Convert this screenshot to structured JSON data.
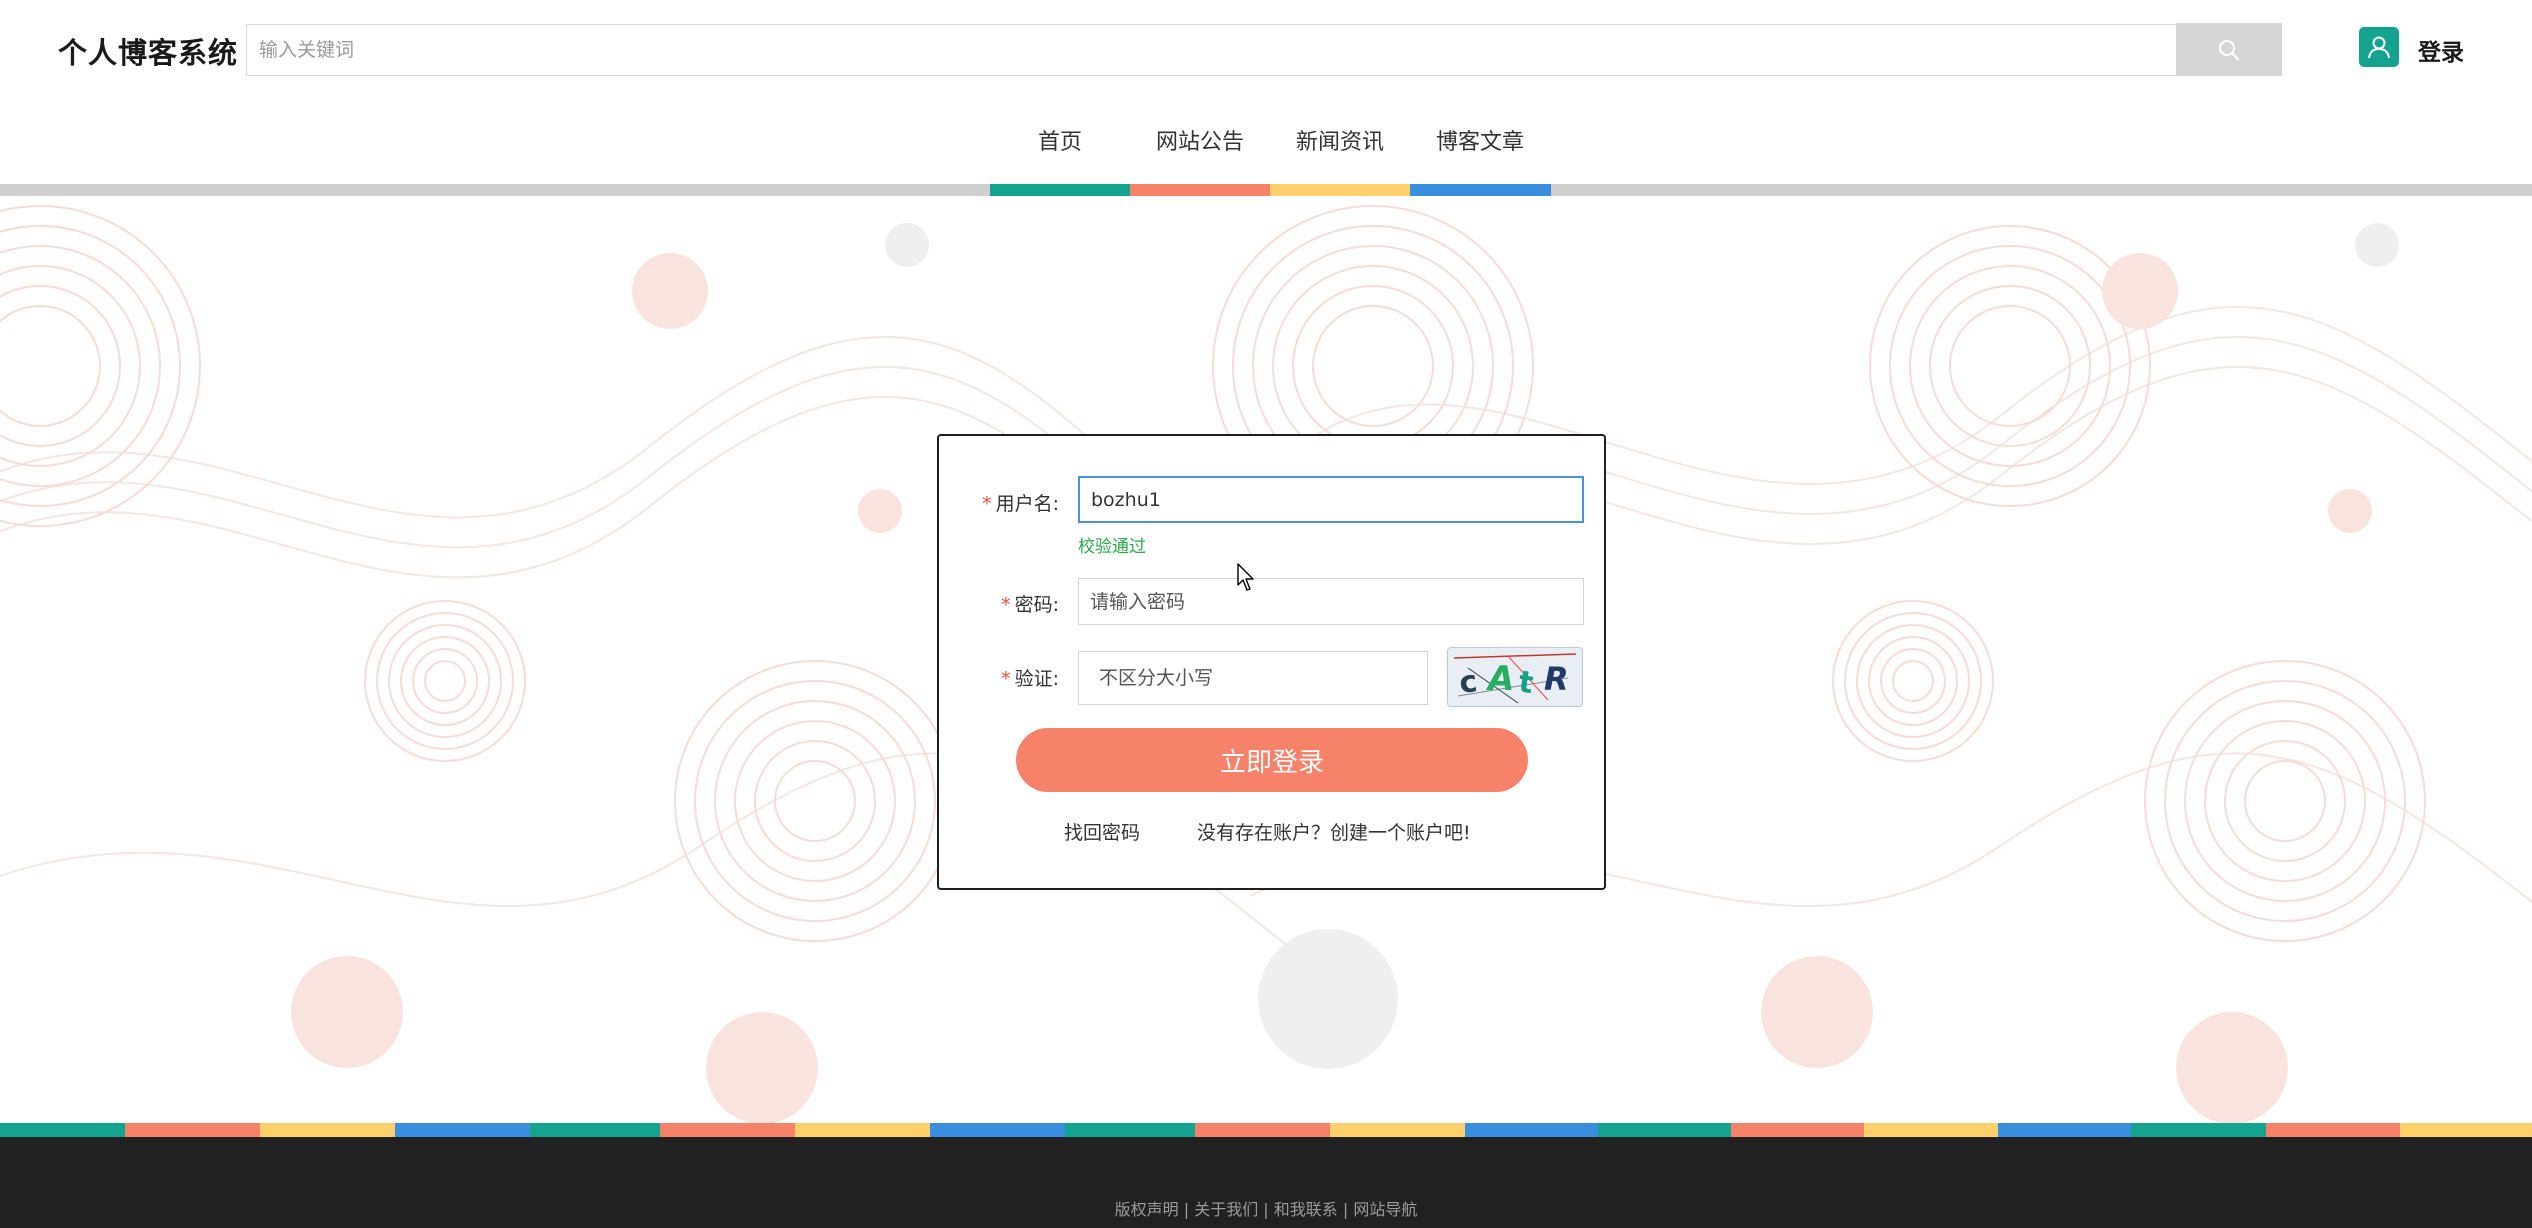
{
  "header": {
    "site_title": "个人博客系统",
    "search_placeholder": "输入关键词",
    "search_icon": "search-icon",
    "user_icon": "user-icon",
    "login_label": "登录"
  },
  "nav": {
    "items": [
      {
        "label": "首页",
        "color": "#14a38f"
      },
      {
        "label": "网站公告",
        "color": "#f7826a"
      },
      {
        "label": "新闻资讯",
        "color": "#fdd06b"
      },
      {
        "label": "博客文章",
        "color": "#3a8ee0"
      }
    ]
  },
  "login_form": {
    "username_label": "用户名:",
    "username_value": "bozhu1",
    "username_valid_msg": "校验通过",
    "password_label": "密码:",
    "password_placeholder": "请输入密码",
    "captcha_label": "验证:",
    "captcha_placeholder": "不区分大小写",
    "captcha_text": "cAtR",
    "submit_label": "立即登录",
    "forgot_password_label": "找回密码",
    "register_label": "没有存在账户？创建一个账户吧!"
  },
  "footer": {
    "links": [
      "版权声明",
      "关于我们",
      "和我联系",
      "网站导航"
    ],
    "separator": "|"
  },
  "colors": {
    "teal": "#14a38f",
    "coral": "#f7826a",
    "yellow": "#fdd06b",
    "blue": "#3a8ee0",
    "footer_bg": "#212121"
  }
}
